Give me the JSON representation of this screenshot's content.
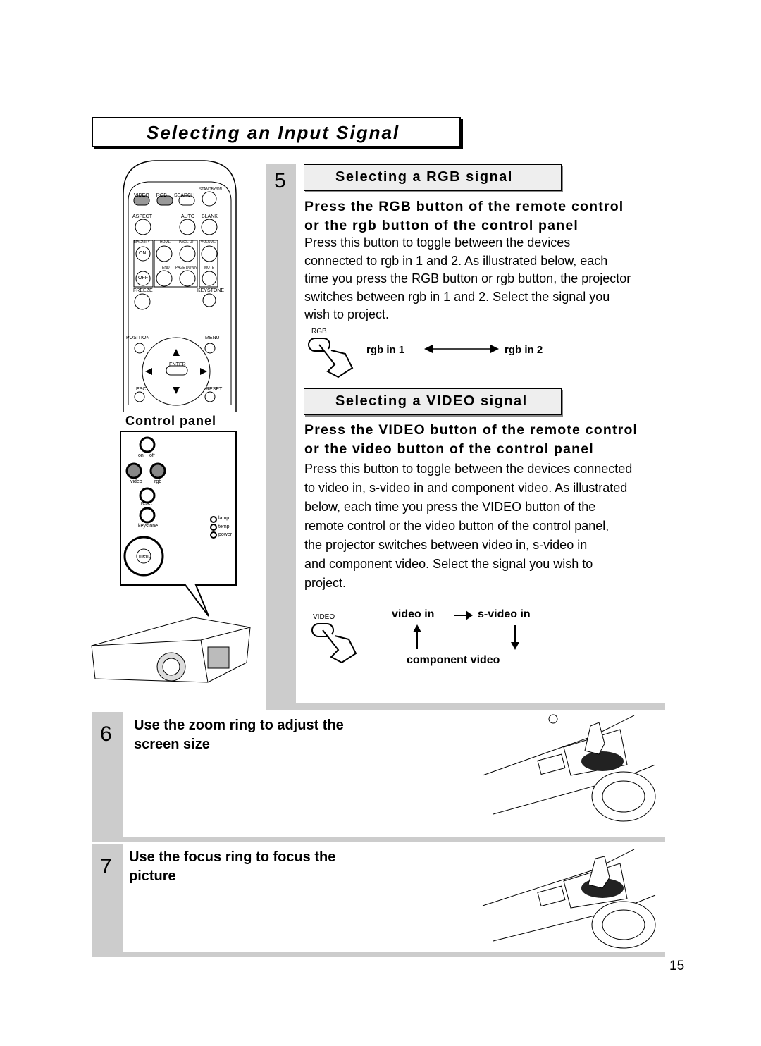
{
  "page_title": "Selecting an Input Signal",
  "remote": {
    "labels": [
      "VIDEO",
      "RGB",
      "SEARCH",
      "STANDBY/ON",
      "ASPECT",
      "AUTO",
      "BLANK",
      "MAGNIFY",
      "ON",
      "OFF",
      "HOME",
      "PAGE UP",
      "END",
      "PAGE DOWN",
      "VOLUME",
      "MUTE",
      "FREEZE",
      "KEYSTONE",
      "POSITION",
      "MENU",
      "ENTER",
      "ESC",
      "RESET"
    ]
  },
  "control_panel": {
    "heading": "Control panel",
    "labels": [
      "on",
      "off",
      "video",
      "rgb",
      "reset",
      "keystone",
      "lamp",
      "temp",
      "power",
      "menu"
    ]
  },
  "step5": {
    "number": "5",
    "rgb": {
      "heading": "Selecting a RGB signal",
      "instruction": [
        "Press the RGB button of the remote control",
        "or the rgb button of the control panel"
      ],
      "body": [
        "Press this button to toggle between the devices",
        "connected to rgb in 1 and 2. As illustrated below, each",
        "time you press the RGB button or rgb button,  the projector",
        "switches between rgb in 1 and 2. Select the signal you",
        "wish to project."
      ],
      "button_label": "RGB",
      "from": "rgb in 1",
      "to": "rgb in 2"
    },
    "video": {
      "heading": "Selecting a VIDEO signal",
      "instruction": [
        "Press the VIDEO button of the remote control",
        "or the video button of the control panel"
      ],
      "body": [
        "Press this button to toggle between the devices connected",
        "to video in, s-video in and component video. As illustrated",
        "below, each time you press the VIDEO  button of the",
        "remote control or the video button of the control panel,",
        "the projector switches between video in, s-video in",
        "and component video. Select the signal you wish to",
        "project."
      ],
      "button_label": "VIDEO",
      "sources": [
        "video in",
        "s-video in",
        "component video"
      ]
    }
  },
  "step6": {
    "number": "6",
    "text": [
      "Use the zoom ring to adjust the",
      "screen size"
    ]
  },
  "step7": {
    "number": "7",
    "text": [
      "Use the focus ring to focus the",
      "picture"
    ]
  },
  "page_number": "15",
  "colors": {
    "panel_gray": "#cccccc"
  }
}
